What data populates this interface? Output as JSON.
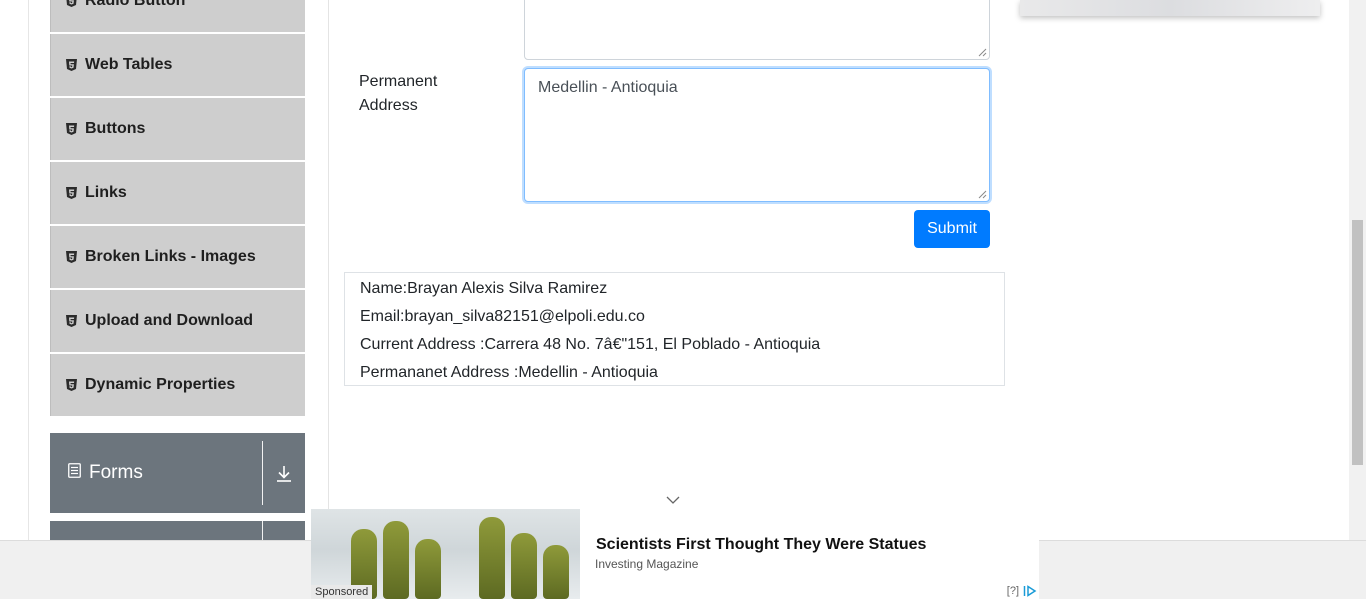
{
  "sidebar": {
    "items": [
      {
        "label": "Radio Button"
      },
      {
        "label": "Web Tables"
      },
      {
        "label": "Buttons"
      },
      {
        "label": "Links"
      },
      {
        "label": "Broken Links - Images"
      },
      {
        "label": "Upload and Download"
      },
      {
        "label": "Dynamic Properties"
      }
    ],
    "groups": [
      {
        "label": "Forms"
      }
    ]
  },
  "form": {
    "permanent_address_label": "Permanent Address",
    "permanent_address_value": "Medellin - Antioquia",
    "submit_label": "Submit"
  },
  "output": {
    "name": "Name:Brayan Alexis Silva Ramirez",
    "email": "Email:brayan_silva82151@elpoli.edu.co",
    "current_address": "Current Address :Carrera 48 No. 7â€\"151, El Poblado - Antioquia",
    "permanent_address": "Permananet Address :Medellin - Antioquia"
  },
  "ad": {
    "title": "Scientists First Thought They Were Statues",
    "source": "Investing Magazine",
    "sponsored": "Sponsored",
    "info": "[?]"
  },
  "icons": {
    "item": "html5-icon",
    "group": "document-icon",
    "group_toggle": "download-arrow-icon"
  }
}
